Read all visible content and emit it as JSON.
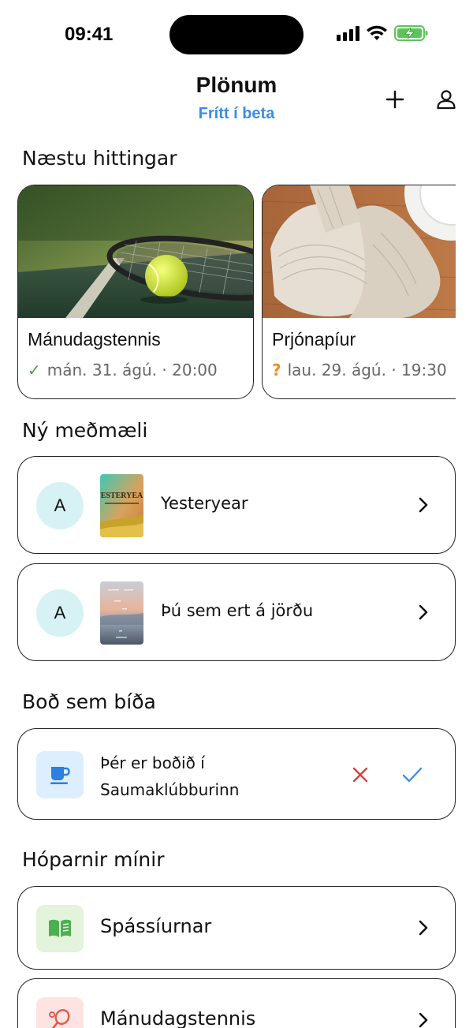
{
  "status_bar": {
    "time": "09:41"
  },
  "header": {
    "title": "Plönum",
    "subtitle": "Frítt í beta"
  },
  "sections": {
    "upcoming": "Næstu hittingar",
    "recommendations": "Ný meðmæli",
    "invites": "Boð sem bíða",
    "groups": "Hóparnir mínir"
  },
  "events": [
    {
      "name": "Mánudagstennis",
      "status": "attending",
      "when": "mán. 31. ágú. · 20:00",
      "image": "tennis-photo"
    },
    {
      "name": "Prjónapíur",
      "status": "maybe",
      "when": "lau. 29. ágú. · 19:30",
      "image": "knitting-photo"
    }
  ],
  "recommendations": [
    {
      "avatar": "A",
      "title": "Yesteryear",
      "cover_text": "YESTERYEAR"
    },
    {
      "avatar": "A",
      "title": "Þú sem ert á jörðu"
    }
  ],
  "invites": [
    {
      "text": "Þér er boðið í Saumaklúbburinn",
      "icon": "coffee-cup-icon"
    }
  ],
  "groups": [
    {
      "name": "Spássíurnar",
      "icon": "book-icon",
      "color": "#4caf50",
      "bg": "#e3f3dc"
    },
    {
      "name": "Mánudagstennis",
      "icon": "tennis-racket-icon",
      "color": "#e05a4f",
      "bg": "#fde3e1"
    }
  ],
  "colors": {
    "accent": "#3b8de0",
    "attending": "#43a047",
    "maybe": "#ef8c1a",
    "decline": "#e53935"
  }
}
